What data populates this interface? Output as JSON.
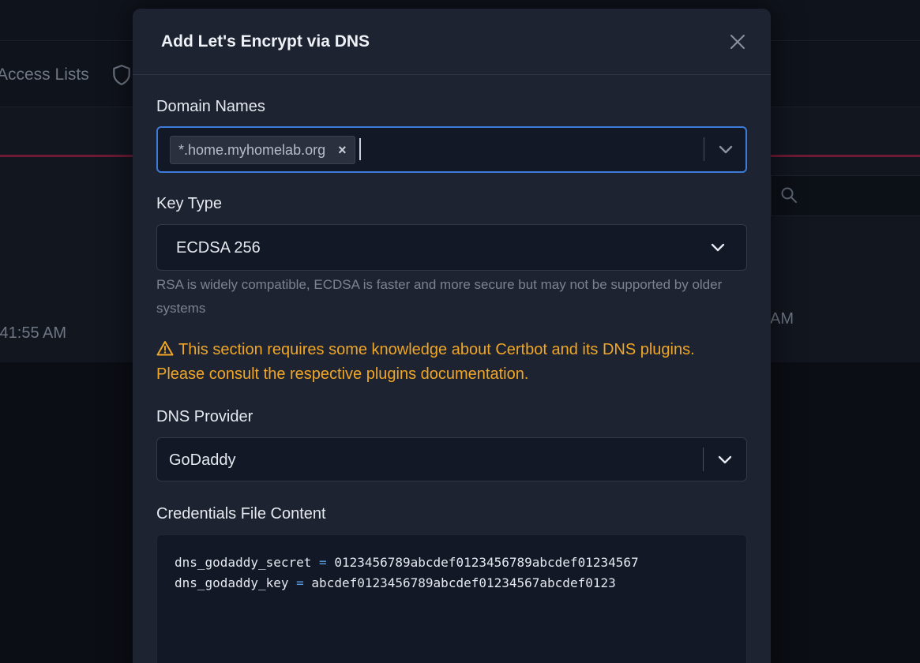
{
  "background": {
    "nav_partial_text": "Access Lists",
    "time_left": ":41:55 AM",
    "time_right": "AM"
  },
  "modal": {
    "title": "Add Let's Encrypt via DNS",
    "domain_names": {
      "label": "Domain Names",
      "tags": [
        "*.home.myhomelab.org"
      ]
    },
    "key_type": {
      "label": "Key Type",
      "value": "ECDSA 256",
      "help": "RSA is widely compatible, ECDSA is faster and more secure but may not be supported by older systems"
    },
    "warning": {
      "line1": "This section requires some knowledge about Certbot and its DNS plugins.",
      "line2": "Please consult the respective plugins documentation."
    },
    "dns_provider": {
      "label": "DNS Provider",
      "value": "GoDaddy"
    },
    "credentials": {
      "label": "Credentials File Content",
      "lines": [
        {
          "key": "dns_godaddy_secret",
          "eq": "=",
          "value": "0123456789abcdef0123456789abcdef01234567"
        },
        {
          "key": "dns_godaddy_key",
          "eq": "=",
          "value": "abcdef0123456789abcdef01234567abcdef0123"
        }
      ]
    }
  },
  "colors": {
    "modal_bg": "#1d2330",
    "field_bg": "#121826",
    "focus_border": "#3d7bd8",
    "warning": "#f0a626",
    "accent_line": "#6e1a36"
  }
}
